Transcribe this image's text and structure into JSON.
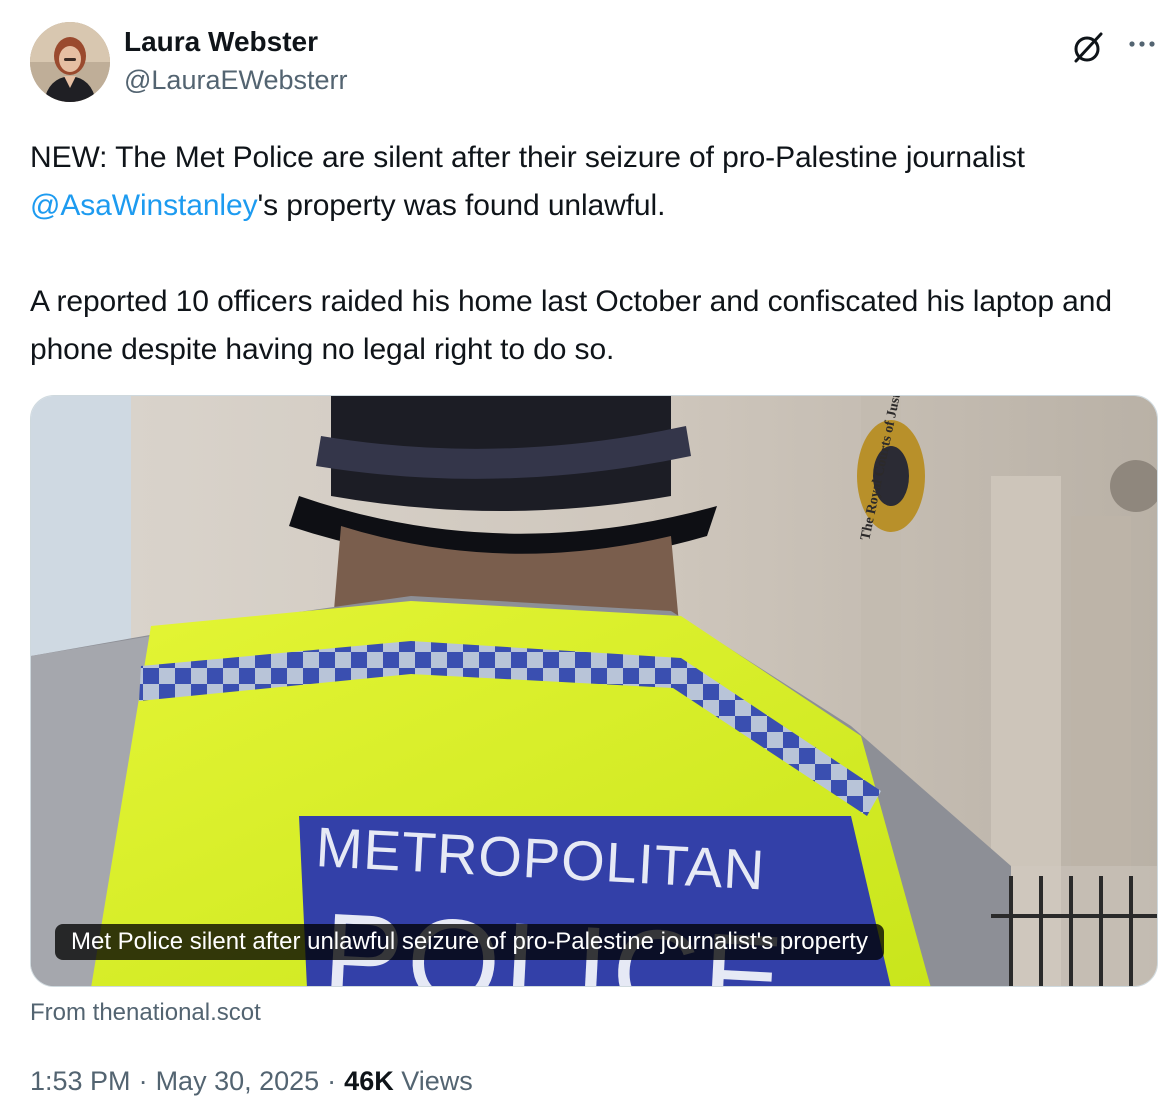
{
  "author": {
    "name": "Laura Webster",
    "handle": "@LauraEWebsterr"
  },
  "icons": {
    "grok": "grok-icon",
    "more": "more-icon"
  },
  "tweet": {
    "paragraph1_before": "NEW: The Met Police are silent after their seizure of pro-Palestine journalist ",
    "mention": "@AsaWinstanley",
    "paragraph1_after": "'s property was found unlawful.",
    "paragraph2": "A reported 10 officers raided his home last October and confiscated his laptop and phone despite having no legal right to do so."
  },
  "card": {
    "image_text": "METROPOLITAN",
    "image_text_partial": "POLICE",
    "building_sign": "The Royal Courts of Justice",
    "caption": "Met Police silent after unlawful seizure of pro-Palestine journalist's property",
    "source": "From thenational.scot"
  },
  "meta": {
    "time": "1:53 PM",
    "date": "May 30, 2025",
    "views_count": "46K",
    "views_label": "Views",
    "separator": "·"
  },
  "colors": {
    "link": "#1d9bf0",
    "text": "#0f1419",
    "secondary": "#536471",
    "hi_vis": "#d7f22a",
    "police_blue": "#3340a8"
  }
}
